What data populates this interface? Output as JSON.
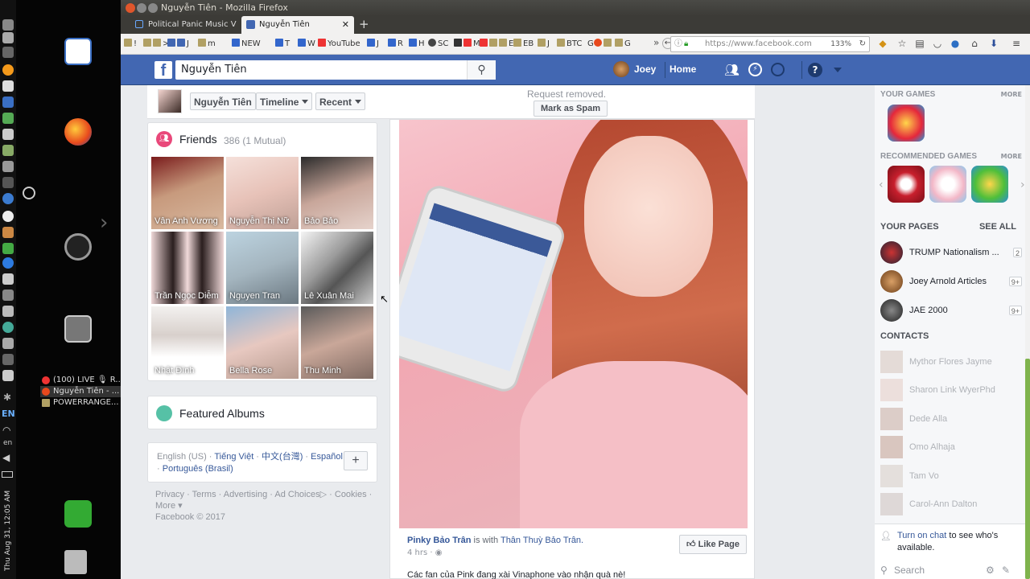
{
  "window": {
    "title": "Nguyễn Tiên - Mozilla Firefox"
  },
  "tabs": [
    {
      "label": "Political Panic Music V",
      "active": false
    },
    {
      "label": "Nguyễn Tiên",
      "active": true
    }
  ],
  "bookmarks": [
    "!",
    ">",
    "J",
    "m",
    "NEW",
    "T",
    "W",
    "YouTube",
    "J",
    "R",
    "H",
    "SC",
    "M",
    "E",
    "EB",
    "J",
    "BTC",
    "G",
    "G"
  ],
  "url": "https://www.facebook.com",
  "zoom": "133%",
  "dock": {
    "tasks": [
      "(100) LIVE 🎙 R...",
      "Nguyễn Tiên - ...",
      "POWERRANGE..."
    ],
    "lang": "EN",
    "lang2": "en",
    "clock": "Thu Aug 31, 12:05 AM"
  },
  "fb": {
    "search_value": "Nguyễn Tiên",
    "user": "Joey",
    "home": "Home"
  },
  "profile": {
    "name": "Nguyễn Tiên",
    "timeline": "Timeline",
    "recent": "Recent",
    "request_removed": "Request removed.",
    "mark_spam": "Mark as Spam"
  },
  "friends": {
    "title": "Friends",
    "count": "386 (1 Mutual)",
    "list": [
      "Vân Anh Vương",
      "Nguyễn Thị Nữ",
      "Bảo Bảo",
      "Trần Ngọc Diễm",
      "Nguyen Tran",
      "Lê Xuân Mai",
      "Nhật Đình",
      "Bella Rose",
      "Thu Minh"
    ]
  },
  "albums": {
    "title": "Featured Albums"
  },
  "languages": {
    "current": "English (US)",
    "others": [
      "Tiếng Việt",
      "中文(台灣)",
      "Español",
      "Português (Brasil)"
    ]
  },
  "footer": {
    "links": [
      "Privacy",
      "Terms",
      "Advertising",
      "Ad Choices",
      "Cookies",
      "More"
    ],
    "copyright": "Facebook © 2017"
  },
  "post": {
    "author": "Pinky Bảo Trân",
    "with_text": "is with",
    "with_name": "Thân Thuỳ Bảo Trân.",
    "time": "4 hrs",
    "like_page": "Like Page",
    "text": "Các fan của Pink đang xài Vinaphone vào nhận quà nè!"
  },
  "right": {
    "your_games": "YOUR GAMES",
    "more": "MORE",
    "recommended": "RECOMMENDED GAMES",
    "your_pages": "YOUR PAGES",
    "see_all": "SEE ALL",
    "pages": [
      {
        "name": "TRUMP Nationalism ...",
        "badge": "2"
      },
      {
        "name": "Joey Arnold Articles",
        "badge": "9+"
      },
      {
        "name": "JAE 2000",
        "badge": "9+"
      }
    ],
    "contacts_title": "CONTACTS",
    "contacts": [
      "Mythor Flores Jayme",
      "Sharon Link WyerPhd",
      "Dede Alla",
      "Omo Alhaja",
      "Tam Vo",
      "Carol-Ann Dalton"
    ],
    "turn_on_chat": "Turn on chat",
    "chat_rest": "to see who's available.",
    "search": "Search"
  },
  "colors": {
    "fb_blue": "#4267b2",
    "link": "#365899"
  }
}
